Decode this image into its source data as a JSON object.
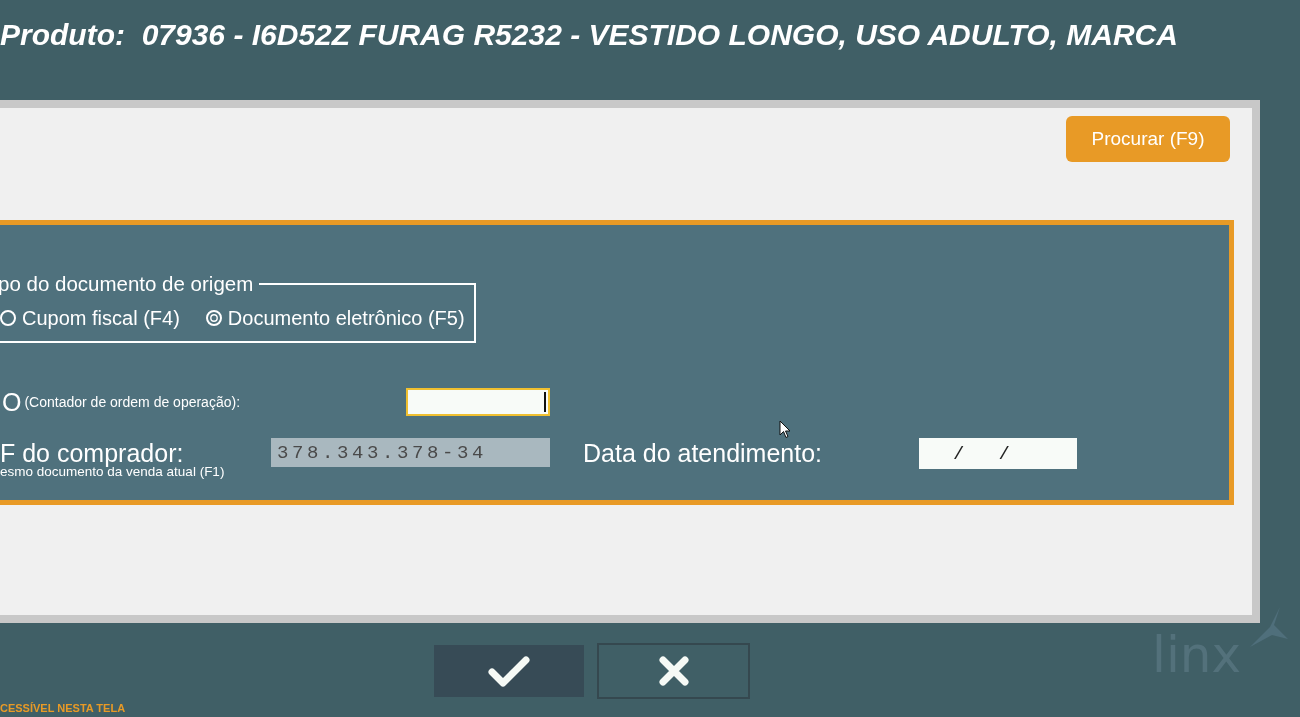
{
  "header": {
    "title": "Produto:  07936 - I6D52Z FURAG R5232 - VESTIDO LONGO, USO ADULTO, MARCA"
  },
  "toolbar": {
    "search_button": "Procurar (F9)"
  },
  "document_type": {
    "legend": "po do documento de origem",
    "options": [
      {
        "label": "Cupom fiscal (F4)",
        "selected": false
      },
      {
        "label": "Documento eletrônico (F5)",
        "selected": true
      }
    ]
  },
  "coo": {
    "label": "O",
    "hint": "(Contador de ordem de operação):",
    "focused": true
  },
  "buyer_cpf": {
    "label": "F do comprador:",
    "note": "esmo documento da venda atual (F1)",
    "value": "378.343.378-34",
    "disabled": true
  },
  "service_date": {
    "label": "Data do atendimento:",
    "value": "/   /"
  },
  "footer": {
    "buttons": [
      {
        "kind": "confirm"
      },
      {
        "kind": "cancel"
      }
    ],
    "notice": "CESSÍVEL NESTA TELA"
  },
  "logo": {
    "text": "linx"
  }
}
